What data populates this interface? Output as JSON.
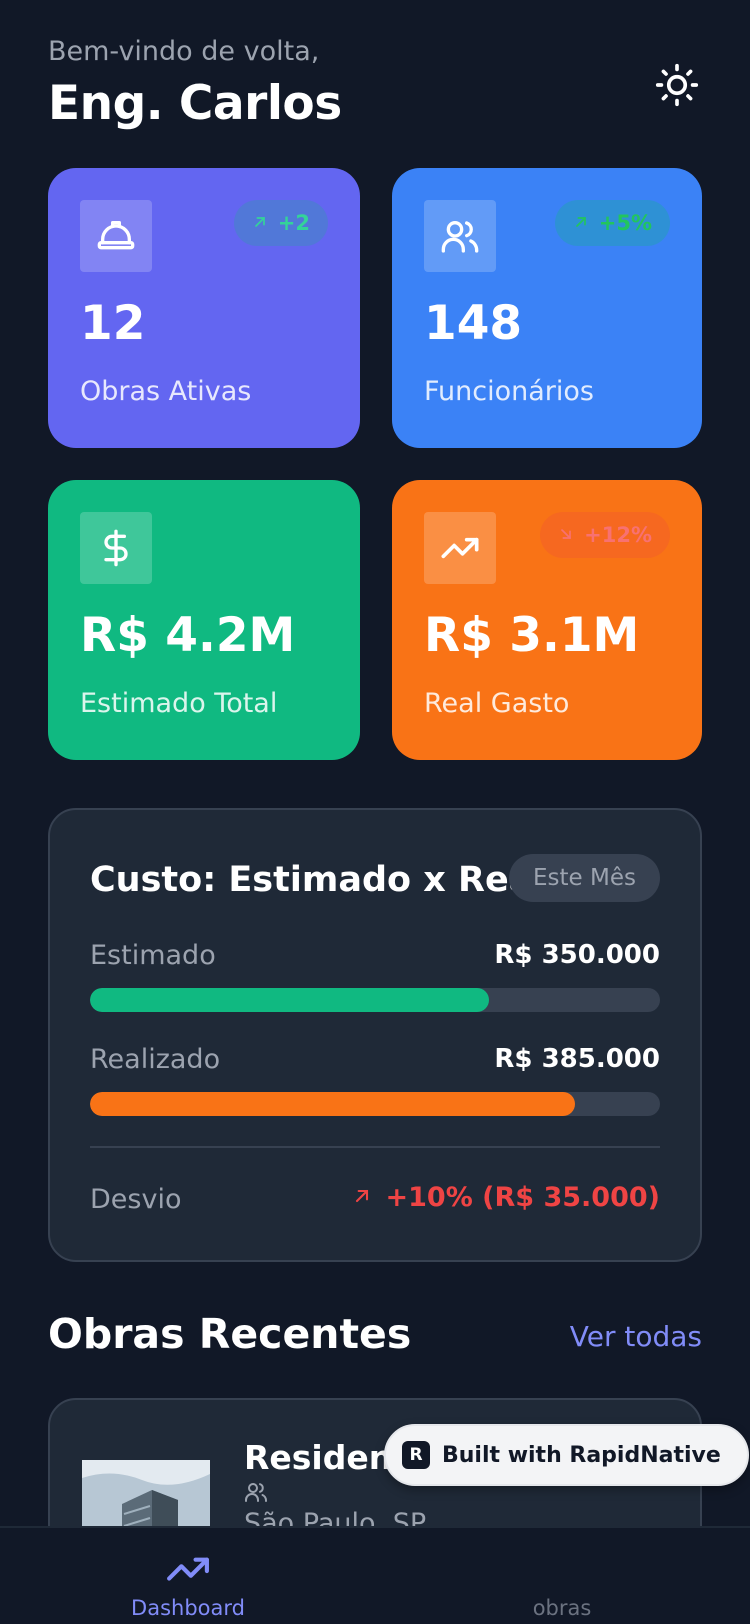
{
  "header": {
    "greeting": "Bem-vindo de volta,",
    "username": "Eng. Carlos",
    "theme_icon": "sun-icon"
  },
  "stats": [
    {
      "icon": "hard-hat-icon",
      "trend": "+2",
      "trend_direction": "up",
      "value": "12",
      "label": "Obras Ativas",
      "color": "#6366f1"
    },
    {
      "icon": "users-icon",
      "trend": "+5%",
      "trend_direction": "up",
      "value": "148",
      "label": "Funcionários",
      "color": "#3b82f6"
    },
    {
      "icon": "dollar-icon",
      "trend": "",
      "value": "R$ 4.2M",
      "label": "Estimado Total",
      "color": "#10b981"
    },
    {
      "icon": "trending-up-icon",
      "trend": "+12%",
      "trend_direction": "down",
      "value": "R$ 3.1M",
      "label": "Real Gasto",
      "color": "#f97316"
    }
  ],
  "cost": {
    "title": "Custo: Estimado x Real",
    "period": "Este Mês",
    "estimated_label": "Estimado",
    "estimated_value": "R$ 350.000",
    "estimated_progress": 0.7,
    "actual_label": "Realizado",
    "actual_value": "R$ 385.000",
    "actual_progress": 0.85,
    "deviation_label": "Desvio",
    "deviation_value": "+10% (R$ 35.000)",
    "estimated_color": "#10b981",
    "actual_color": "#f97316",
    "deviation_color": "#ef4444"
  },
  "recent": {
    "title": "Obras Recentes",
    "see_all": "Ver todas",
    "items": [
      {
        "name": "Residenc",
        "location": "São Paulo, SP"
      }
    ]
  },
  "watermark": {
    "label": "Built with RapidNative"
  },
  "nav": {
    "items": [
      {
        "label": "Dashboard",
        "icon": "trending-up-icon",
        "active": true
      },
      {
        "label": "obras",
        "icon": "",
        "active": false
      }
    ]
  }
}
